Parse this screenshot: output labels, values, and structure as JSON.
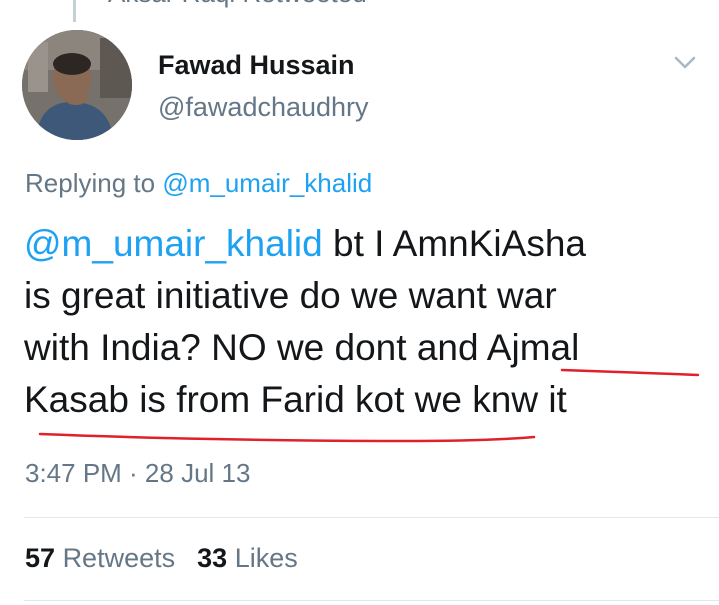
{
  "retweet_context": {
    "text": "Aksar Raqi Retweeted"
  },
  "author": {
    "name": "Fawad Hussain",
    "handle": "@fawadchaudhry"
  },
  "reply": {
    "prefix": "Replying to",
    "mention": "@m_umair_khalid"
  },
  "tweet": {
    "mention": "@m_umair_khalid",
    "line1_rest": " bt I AmnKiAsha",
    "line2": "is great initiative do we want war",
    "line3_a": "with India? NO we dont and ",
    "line3_b": "Ajmal",
    "line4": "Kasab is from Farid kot we knw it"
  },
  "timestamp": "3:47 PM · 28 Jul 13",
  "stats": {
    "retweets_count": "57",
    "retweets_label": "Retweets",
    "likes_count": "33",
    "likes_label": "Likes"
  },
  "colors": {
    "link": "#1da1f2",
    "muted": "#657786",
    "text": "#14171a",
    "annotation": "#e0202a"
  }
}
